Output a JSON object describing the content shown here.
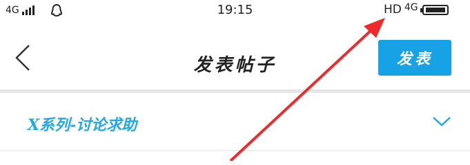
{
  "status_bar": {
    "network_left": "4G",
    "time": "19:15",
    "hd": "HD",
    "network_right": "4G",
    "qq_icon": "qq-penguin-icon",
    "signal_icon": "signal-bars-icon",
    "battery_icon": "battery-icon"
  },
  "nav": {
    "back_icon": "chevron-left-icon",
    "title": "发表帖子",
    "publish_label": "发表",
    "publish_color": "#18a2e6"
  },
  "category": {
    "label": "X系列-讨论求助",
    "text_color": "#22a8e6",
    "dropdown_icon": "chevron-down-icon"
  },
  "annotation": {
    "arrow_color": "#ee2a2a",
    "arrow_icon": "red-annotation-arrow"
  }
}
